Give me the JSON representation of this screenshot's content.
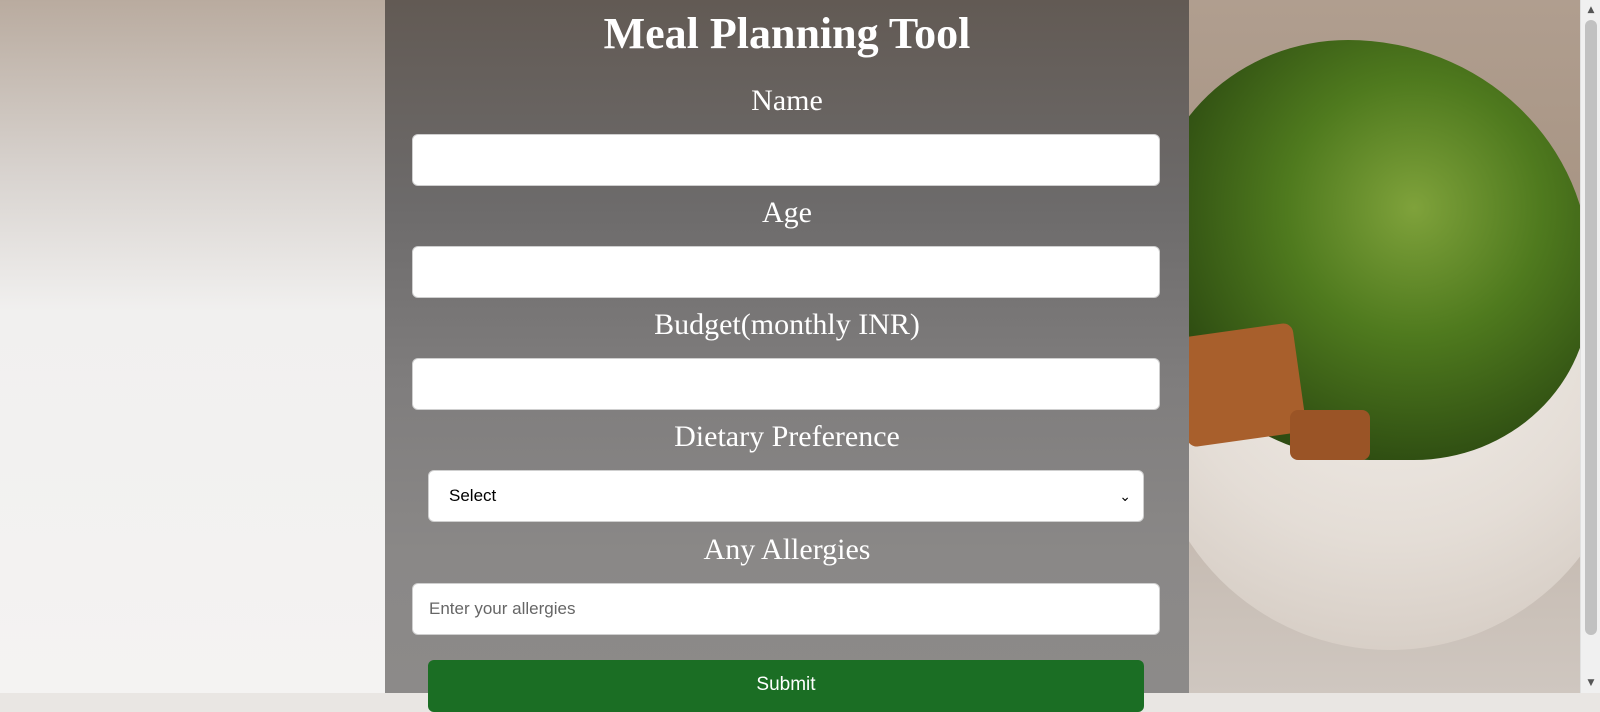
{
  "form": {
    "title": "Meal Planning Tool",
    "fields": {
      "name_label": "Name",
      "name_value": "",
      "age_label": "Age",
      "age_value": "",
      "budget_label": "Budget(monthly INR)",
      "budget_value": "",
      "diet_label": "Dietary Preference",
      "diet_selected": "Select",
      "allergies_label": "Any Allergies",
      "allergies_placeholder": "Enter your allergies"
    },
    "submit_label": "Submit"
  },
  "icons": {
    "select_chevron": "chevron-down-icon",
    "scroll_up": "triangle-up-icon",
    "scroll_down": "triangle-down-icon"
  },
  "colors": {
    "submit_bg": "#1b6e24",
    "panel_overlay": "#6d6b6b"
  }
}
